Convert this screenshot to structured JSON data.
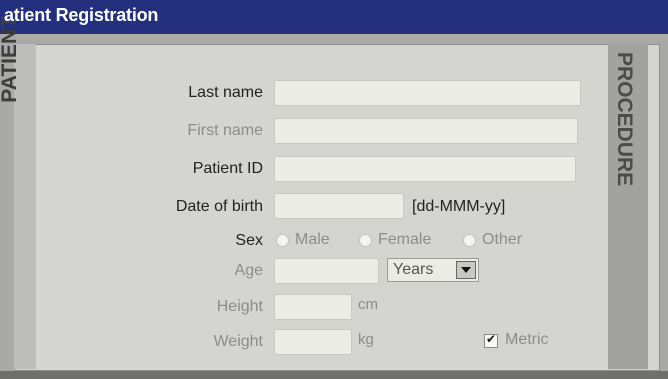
{
  "window": {
    "title": "atient Registration"
  },
  "side_labels": {
    "left": "PATIENT",
    "right": "PROCEDURE"
  },
  "form": {
    "last_name": {
      "label": "Last name",
      "value": ""
    },
    "first_name": {
      "label": "First name",
      "value": ""
    },
    "patient_id": {
      "label": "Patient ID",
      "value": ""
    },
    "dob": {
      "label": "Date of birth",
      "value": "",
      "format_hint": "[dd-MMM-yy]"
    },
    "sex": {
      "label": "Sex",
      "options": [
        "Male",
        "Female",
        "Other"
      ]
    },
    "age": {
      "label": "Age",
      "value": "",
      "unit_selected": "Years"
    },
    "height": {
      "label": "Height",
      "value": "",
      "unit": "cm"
    },
    "weight": {
      "label": "Weight",
      "value": "",
      "unit": "kg"
    },
    "metric": {
      "label": "Metric",
      "checked": true
    }
  },
  "colors": {
    "title_bar": "#23307e",
    "panel": "#d4d4d0",
    "field": "#ecece7"
  }
}
